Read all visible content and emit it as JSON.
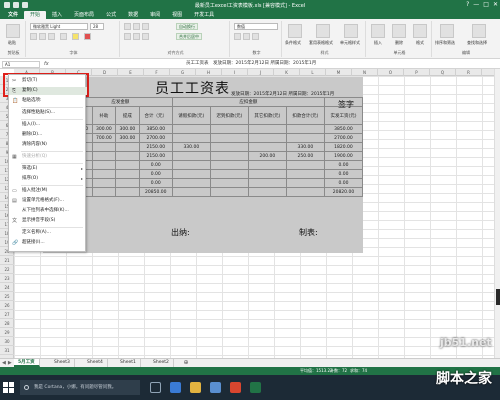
{
  "window": {
    "title": "最新员工excel工资表模板.xls [兼容模式] - Excel",
    "controls": [
      "?",
      "—",
      "□",
      "✕"
    ]
  },
  "ribbon": {
    "tabs": [
      "文件",
      "开始",
      "插入",
      "页面布局",
      "公式",
      "数据",
      "审阅",
      "视图",
      "开发工具"
    ],
    "font_name": "微软雅黑 Light",
    "font_size": "28",
    "number_format": "数值",
    "groups": {
      "clipboard": "剪贴板",
      "font": "字体",
      "alignment": "对齐方式",
      "number": "数字",
      "styles": "样式",
      "cells": "单元格",
      "editing": "编辑"
    },
    "buttons": {
      "paste": "粘贴",
      "wrap_text": "自动换行",
      "merge_center": "合并后居中",
      "conditional_format": "条件格式",
      "table_format": "套用表格格式",
      "cell_styles": "单元格样式",
      "insert": "插入",
      "delete": "删除",
      "format": "格式",
      "sort_filter": "排序和筛选",
      "find_select": "查找和选择"
    }
  },
  "formula_bar": {
    "name_box": "A1",
    "fx": "fx",
    "value": "员工工资表　发放日期：2015年2月12日 所属日期：2015年1月"
  },
  "columns": [
    "A",
    "B",
    "C",
    "D",
    "E",
    "F",
    "G",
    "H",
    "I",
    "J",
    "K",
    "L",
    "M",
    "N",
    "O",
    "P",
    "Q",
    "R"
  ],
  "rows": [
    "1",
    "2",
    "3",
    "4",
    "5",
    "6",
    "7",
    "8",
    "9",
    "10",
    "11",
    "12",
    "13",
    "14",
    "15",
    "16",
    "17",
    "18",
    "19",
    "20",
    "21",
    "22",
    "23",
    "24",
    "25",
    "26",
    "27",
    "28",
    "29",
    "30",
    "31"
  ],
  "report": {
    "title": "员工工资表",
    "subtitle": "发放日期：2015年2月12日 所属日期：2015年1月",
    "sign_label": "签字",
    "cashier_label": "出纳:",
    "maker_label": "制表:",
    "header_group_payable": "应发金额",
    "header_group_deduct": "应扣金额",
    "headers": [
      "",
      "",
      "奖金",
      "补助",
      "提成",
      "合计（元）",
      "请假扣款(元)",
      "迟到扣款(元)",
      "其它扣款(元)",
      "扣款合计(元)",
      "实发工资(元)"
    ],
    "rows": [
      [
        "",
        "100.00",
        "100.00",
        "300.00",
        "300.00",
        "3850.00",
        "",
        "",
        "",
        "",
        "3850.00"
      ],
      [
        "",
        "",
        "",
        "700.00",
        "300.00",
        "2700.00",
        "",
        "",
        "",
        "",
        "2700.00"
      ],
      [
        "",
        "",
        "",
        "",
        "",
        "2150.00",
        "330.00",
        "",
        "",
        "330.00",
        "1820.00"
      ],
      [
        "",
        "",
        "",
        "",
        "",
        "2150.00",
        "",
        "",
        "200.00",
        "250.00",
        "1900.00"
      ],
      [
        "",
        "",
        "",
        "",
        "",
        "0.00",
        "",
        "",
        "",
        "",
        "0.00"
      ],
      [
        "",
        "",
        "",
        "",
        "",
        "0.00",
        "",
        "",
        "",
        "",
        "0.00"
      ],
      [
        "",
        "",
        "",
        "",
        "",
        "0.00",
        "",
        "",
        "",
        "",
        "0.00"
      ],
      [
        "",
        "",
        "",
        "",
        "",
        "20850.00",
        "",
        "",
        "",
        "",
        "20820.00"
      ]
    ]
  },
  "context_menu": {
    "items": [
      {
        "label": "剪切(T)",
        "icon": "scissors-icon",
        "glyph": "✂",
        "disabled": false,
        "submenu": false
      },
      {
        "label": "复制(C)",
        "icon": "copy-icon",
        "glyph": "⎘",
        "disabled": false,
        "submenu": false,
        "highlight": true
      },
      {
        "label": "粘贴选项:",
        "icon": "paste-icon",
        "glyph": "📋",
        "disabled": false,
        "submenu": false
      },
      {
        "label": "选择性粘贴(S)...",
        "icon": "",
        "glyph": "",
        "disabled": false,
        "submenu": false
      },
      {
        "label": "插入(I)...",
        "icon": "",
        "glyph": "",
        "disabled": false,
        "submenu": false
      },
      {
        "label": "删除(D)...",
        "icon": "",
        "glyph": "",
        "disabled": false,
        "submenu": false
      },
      {
        "label": "清除内容(N)",
        "icon": "",
        "glyph": "",
        "disabled": false,
        "submenu": false
      },
      {
        "label": "快速分析(Q)",
        "icon": "quick-analysis-icon",
        "glyph": "▦",
        "disabled": true,
        "submenu": false
      },
      {
        "label": "筛选(E)",
        "icon": "",
        "glyph": "",
        "disabled": false,
        "submenu": true
      },
      {
        "label": "排序(O)",
        "icon": "",
        "glyph": "",
        "disabled": false,
        "submenu": true
      },
      {
        "label": "插入批注(M)",
        "icon": "comment-icon",
        "glyph": "▭",
        "disabled": false,
        "submenu": false
      },
      {
        "label": "设置单元格格式(F)...",
        "icon": "format-cells-icon",
        "glyph": "▤",
        "disabled": false,
        "submenu": false
      },
      {
        "label": "从下拉列表中选择(K)...",
        "icon": "",
        "glyph": "",
        "disabled": false,
        "submenu": false
      },
      {
        "label": "显示拼音字段(S)",
        "icon": "pinyin-icon",
        "glyph": "文",
        "disabled": false,
        "submenu": false
      },
      {
        "label": "定义名称(A)...",
        "icon": "",
        "glyph": "",
        "disabled": false,
        "submenu": false
      },
      {
        "label": "超链接(I)...",
        "icon": "hyperlink-icon",
        "glyph": "🔗",
        "disabled": false,
        "submenu": false
      }
    ]
  },
  "sheet_tabs": [
    "5月工资",
    "Sheet3",
    "Sheet4",
    "Sheet1",
    "Sheet2"
  ],
  "status_bar": {
    "average": "平均值：1513.22",
    "count": "计数：72",
    "sum": "求和：74"
  },
  "taskbar": {
    "cortana": "我是 Cortana，小娜。有问题尽管问我。"
  },
  "watermark": {
    "site": "jb51.net",
    "brand": "脚本之家"
  },
  "colors": {
    "excel_green": "#217346",
    "highlight_box": "#e0201b"
  }
}
